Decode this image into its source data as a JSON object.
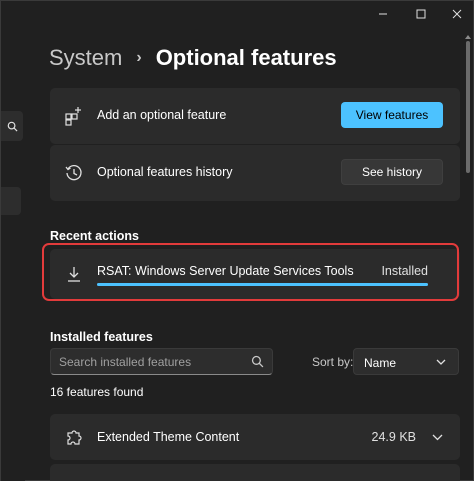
{
  "breadcrumb": {
    "parent": "System",
    "separator": "›",
    "current": "Optional features"
  },
  "add_feature": {
    "label": "Add an optional feature",
    "button": "View features",
    "icon": "add-apps-icon"
  },
  "history": {
    "label": "Optional features history",
    "button": "See history",
    "icon": "history-icon"
  },
  "recent_actions": {
    "title": "Recent actions",
    "item": {
      "label": "RSAT: Windows Server Update Services Tools",
      "status": "Installed",
      "progress": 1.0,
      "icon": "download-icon"
    }
  },
  "installed": {
    "title": "Installed features",
    "search_placeholder": "Search installed features",
    "sort_label": "Sort by:",
    "sort_value": "Name",
    "count_text": "16 features found",
    "items": [
      {
        "label": "Extended Theme Content",
        "size": "24.9 KB",
        "icon": "puzzle-icon"
      }
    ]
  },
  "colors": {
    "accent": "#4cc2ff",
    "highlight": "#e23b3b",
    "card": "#2b2b2b",
    "background": "#202020"
  }
}
